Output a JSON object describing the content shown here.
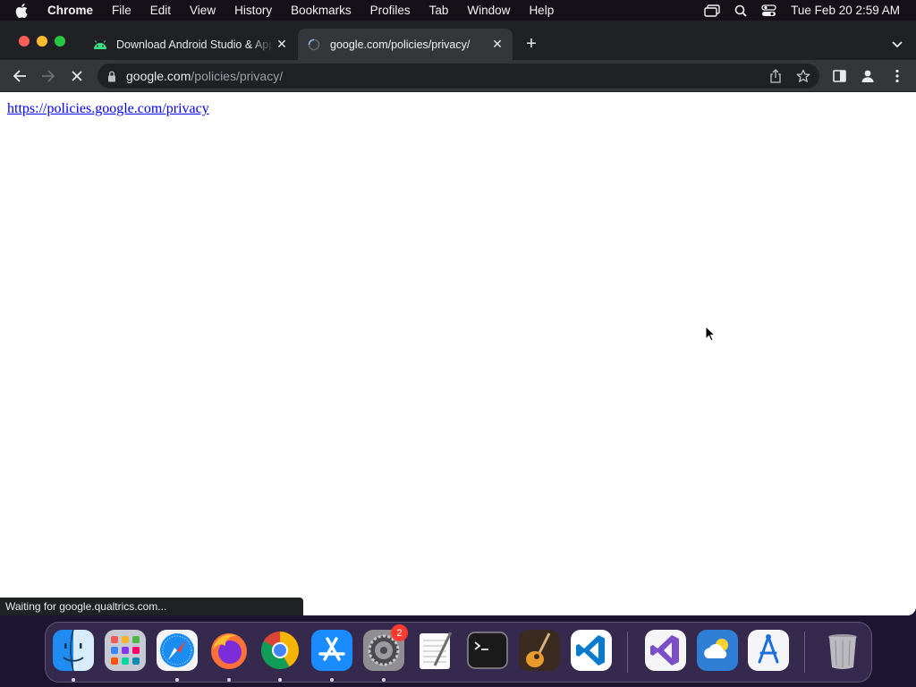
{
  "menubar": {
    "app_name": "Chrome",
    "items": [
      "File",
      "Edit",
      "View",
      "History",
      "Bookmarks",
      "Profiles",
      "Tab",
      "Window",
      "Help"
    ],
    "clock": "Tue Feb 20  2:59 AM"
  },
  "tabs": [
    {
      "title": "Download Android Studio & App Tools - Android Developers",
      "favicon": "android-icon",
      "active": false
    },
    {
      "title": "google.com/policies/privacy/",
      "favicon": "loading-spinner-icon",
      "active": true
    }
  ],
  "toolbar": {
    "url_host": "google.com",
    "url_path": "/policies/privacy/",
    "reload_state": "stop-icon"
  },
  "page": {
    "link_text": "https://policies.google.com/privacy"
  },
  "status": {
    "text": "Waiting for google.qualtrics.com..."
  },
  "dock": {
    "apps": [
      "finder-icon",
      "launchpad-icon",
      "safari-icon",
      "firefox-icon",
      "chrome-icon",
      "app-store-icon",
      "system-settings-icon",
      "textedit-icon",
      "terminal-icon",
      "garageband-icon",
      "vscode-icon",
      "visual-studio-icon",
      "weather-icon",
      "xcode-instruments-icon",
      "trash-icon"
    ],
    "settings_badge": "2"
  },
  "colors": {
    "tab_strip": "#202124",
    "toolbar": "#35363a",
    "link": "#0000ee",
    "dock": "#3a2e54"
  }
}
